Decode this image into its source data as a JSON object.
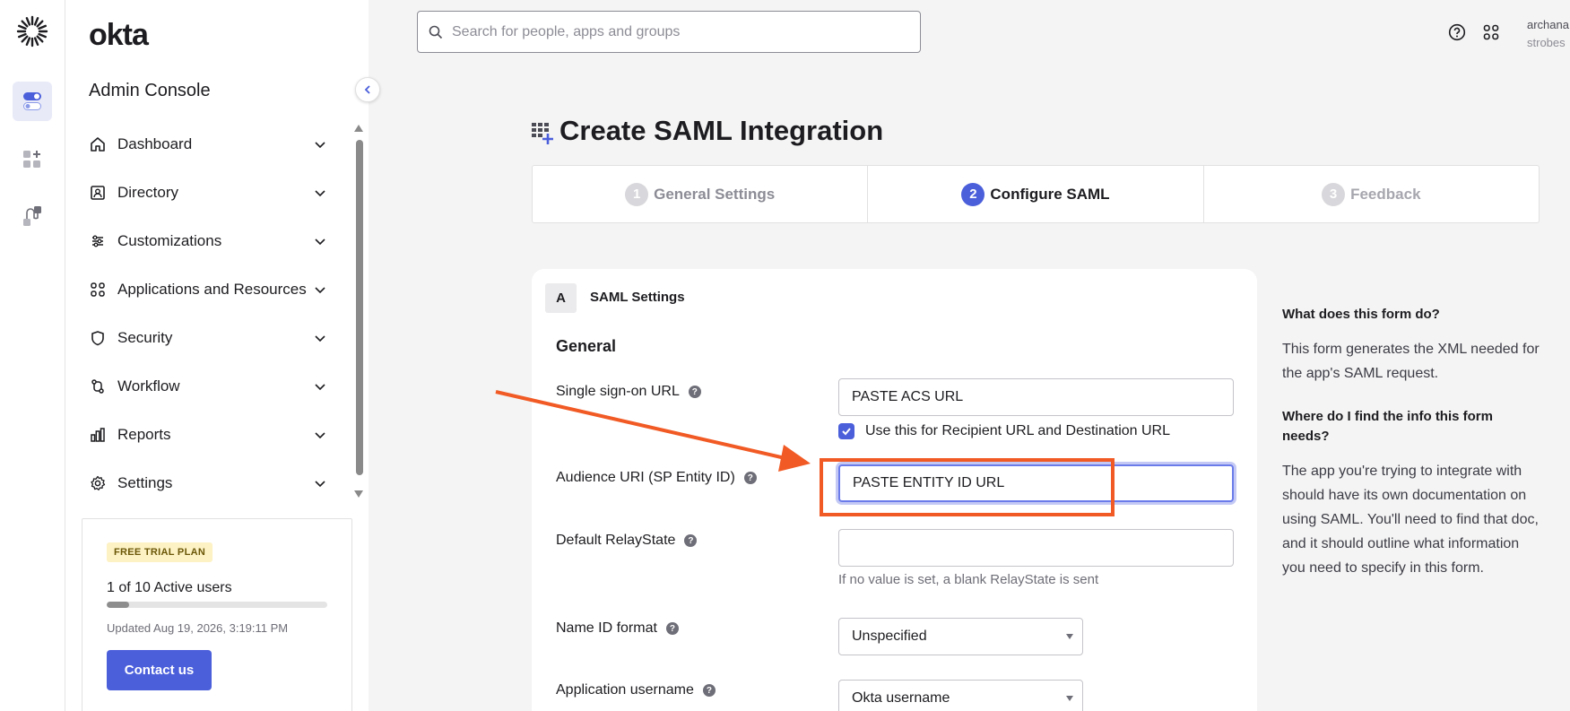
{
  "brand": {
    "name": "okta"
  },
  "sidebar": {
    "title": "Admin Console",
    "items": [
      {
        "label": "Dashboard",
        "icon": "home-icon"
      },
      {
        "label": "Directory",
        "icon": "directory-icon"
      },
      {
        "label": "Customizations",
        "icon": "sliders-icon"
      },
      {
        "label": "Applications and Resources",
        "icon": "grid-icon"
      },
      {
        "label": "Security",
        "icon": "shield-icon"
      },
      {
        "label": "Workflow",
        "icon": "workflow-icon"
      },
      {
        "label": "Reports",
        "icon": "bar-chart-icon"
      },
      {
        "label": "Settings",
        "icon": "gear-icon"
      }
    ],
    "trial": {
      "badge": "FREE TRIAL PLAN",
      "users_text": "1 of 10 Active users",
      "users_active_fraction": 0.1,
      "updated": "Updated Aug 19, 2026, 3:19:11 PM",
      "contact_label": "Contact us"
    }
  },
  "header": {
    "search_placeholder": "Search for people, apps and groups",
    "user_name": "archana",
    "user_org": "strobes"
  },
  "page": {
    "title": "Create SAML Integration",
    "steps": [
      {
        "num": "1",
        "label": "General Settings",
        "state": "done"
      },
      {
        "num": "2",
        "label": "Configure SAML",
        "state": "current"
      },
      {
        "num": "3",
        "label": "Feedback",
        "state": "todo"
      }
    ]
  },
  "form": {
    "section_letter": "A",
    "section_title": "SAML Settings",
    "group_title": "General",
    "sso_url_label": "Single sign-on URL",
    "sso_url_value": "PASTE ACS URL",
    "recipient_checkbox_label": "Use this for Recipient URL and Destination URL",
    "audience_label": "Audience URI (SP Entity ID)",
    "audience_value": "PASTE ENTITY ID URL",
    "relay_label": "Default RelayState",
    "relay_value": "",
    "relay_hint": "If no value is set, a blank RelayState is sent",
    "nameid_label": "Name ID format",
    "nameid_value": "Unspecified",
    "username_label": "Application username",
    "username_value": "Okta username"
  },
  "aside": {
    "q1": "What does this form do?",
    "a1": "This form generates the XML needed for the app's SAML request.",
    "q2": "Where do I find the info this form needs?",
    "a2": "The app you're trying to integrate with should have its own documentation on using SAML. You'll need to find that doc, and it should outline what information you need to specify in this form."
  },
  "colors": {
    "accent": "#4b5fdb",
    "annotation": "#f15a24",
    "trial_badge_bg": "#fdf2c4"
  }
}
